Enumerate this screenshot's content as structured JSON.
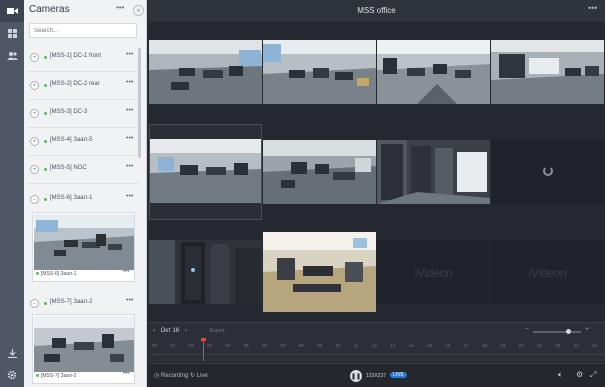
{
  "panel": {
    "title": "Cameras",
    "menu_dots": "•••",
    "collapse": "«",
    "search_placeholder": "Search..."
  },
  "cameras": [
    {
      "label": "[MSS-1] DC-1 front",
      "more": "•••",
      "expand": "+"
    },
    {
      "label": "[MSS-2] DC-2 rear",
      "more": "•••",
      "expand": "+"
    },
    {
      "label": "[MSS-3] DC-3",
      "more": "•••",
      "expand": "+"
    },
    {
      "label": "[MSS-4] Заал-5",
      "more": "•••",
      "expand": "+"
    },
    {
      "label": "[MSS-5] NOC",
      "more": "•••",
      "expand": "+"
    },
    {
      "label": "[MSS-6] Заал-1",
      "more": "•••",
      "expand": "−"
    },
    {
      "label": "[MSS-7] Заал-2",
      "more": "•••",
      "expand": "−"
    }
  ],
  "thumbs": [
    {
      "caption": "[MSS-6] Заал-1",
      "more": "•••"
    },
    {
      "caption": "[MSS-7] Заал-2",
      "more": "•••"
    }
  ],
  "main": {
    "title": "MSS office",
    "menu": "•••",
    "logo_text": "iVideon"
  },
  "timeline": {
    "prev": "‹",
    "date": "Окт 16",
    "next": "›",
    "export": "Export",
    "minus": "−",
    "plus": "+",
    "ticks": [
      "00",
      "01",
      "02",
      "03",
      "04",
      "05",
      "06",
      "07",
      "08",
      "09",
      "10",
      "11",
      "12",
      "13",
      "14",
      "15",
      "16",
      "17",
      "18",
      "19",
      "20",
      "21",
      "22",
      "23",
      "24"
    ]
  },
  "bottombar": {
    "recording": "Recording",
    "live": "Live",
    "play": "❚❚",
    "resolution": "123X237",
    "live_badge": "LIVE"
  },
  "colors": {
    "accent": "#2d77d6",
    "playhead": "#e64646",
    "online": "#5eb85e"
  }
}
